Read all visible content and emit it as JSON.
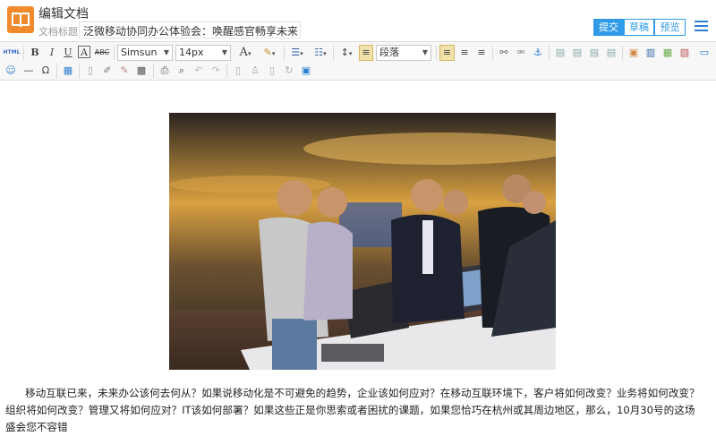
{
  "header": {
    "app_title": "编辑文档",
    "doc_title_label": "文档标题:",
    "doc_title_value": "泛微移动协同办公体验会：唤醒感官畅享未来",
    "submit_label": "提交",
    "draft_label": "草稿",
    "preview_label": "预览"
  },
  "toolbar": {
    "html_label": "HTML",
    "font_family": "Simsun",
    "font_size": "14px",
    "paragraph": "段落"
  },
  "article": {
    "body": "移动互联已来，未来办公该何去何从？如果说移动化是不可避免的趋势，企业该如何应对？在移动互联环境下，客户将如何改变？业务将如何改变？组织将如何改变？管理又将如何应对？IT该如何部署？如果这些正是你思索或者困扰的课题，如果您恰巧在杭州或其周边地区，那么，10月30号的这场盛会您不容错"
  },
  "colors": {
    "accent": "#2f9be6",
    "app_icon": "#f08a2c"
  }
}
